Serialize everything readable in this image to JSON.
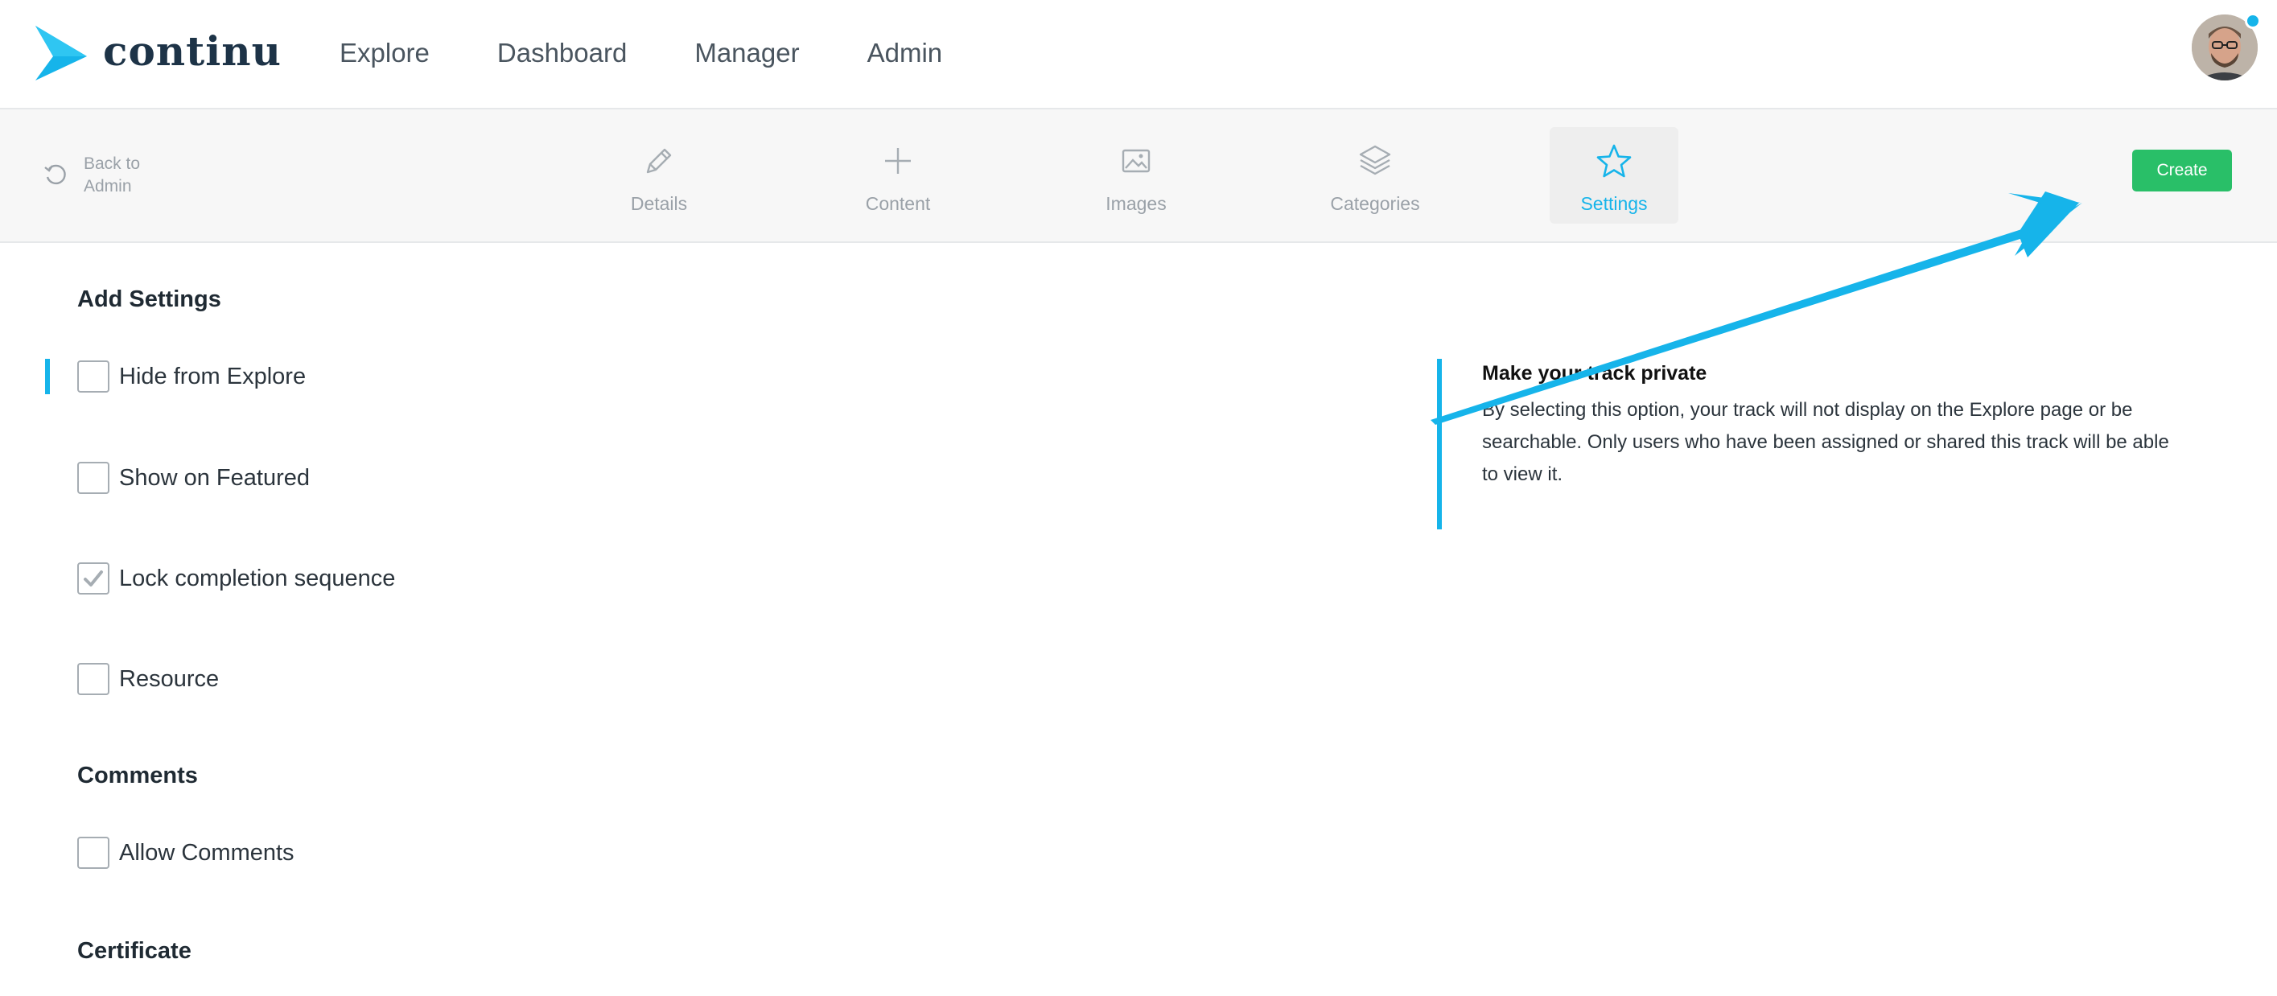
{
  "brand": {
    "name": "continu",
    "color": "#1d3347",
    "accent": "#16b4ea"
  },
  "nav": {
    "links": [
      "Explore",
      "Dashboard",
      "Manager",
      "Admin"
    ]
  },
  "user": {
    "avatar_icon": "user-avatar",
    "notification_color": "#16b4ea"
  },
  "stepbar": {
    "back_label": "Back to Admin",
    "steps": [
      {
        "label": "Details",
        "icon": "pencil-icon",
        "active": false
      },
      {
        "label": "Content",
        "icon": "plus-icon",
        "active": false
      },
      {
        "label": "Images",
        "icon": "image-icon",
        "active": false
      },
      {
        "label": "Categories",
        "icon": "layers-icon",
        "active": false
      },
      {
        "label": "Settings",
        "icon": "star-icon",
        "active": true
      }
    ],
    "create_label": "Create",
    "create_color": "#29bf68"
  },
  "settings": {
    "heading": "Add Settings",
    "options": [
      {
        "label": "Hide from Explore",
        "checked": false
      },
      {
        "label": "Show on Featured",
        "checked": false
      },
      {
        "label": "Lock completion sequence",
        "checked": true
      },
      {
        "label": "Resource",
        "checked": false
      }
    ]
  },
  "comments": {
    "heading": "Comments",
    "options": [
      {
        "label": "Allow Comments",
        "checked": false
      }
    ]
  },
  "certificate": {
    "heading": "Certificate"
  },
  "help": {
    "title": "Make your track private",
    "body": "By selecting this option, your track will not display on the Explore page or be searchable. Only users who have been assigned or shared this track will be able to view it."
  },
  "annotation": {
    "type": "arrow",
    "color": "#16b4ea"
  }
}
